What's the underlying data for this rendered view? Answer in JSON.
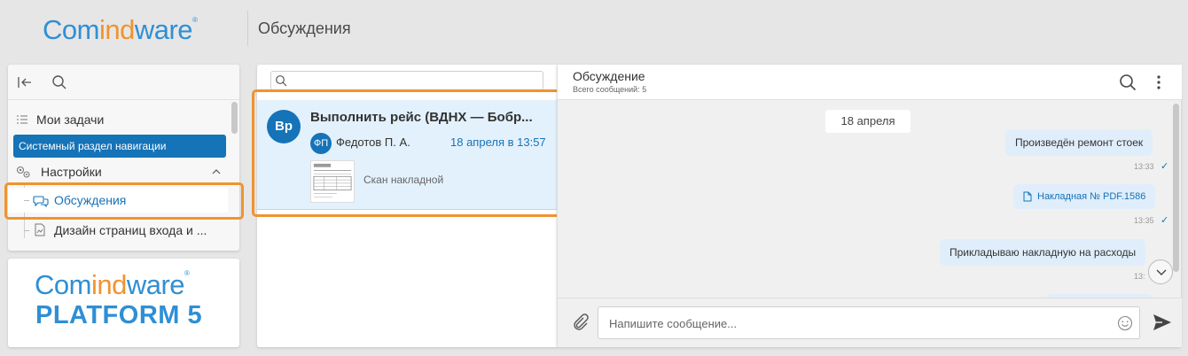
{
  "header": {
    "logo_part1": "Com",
    "logo_part2": "ind",
    "logo_part3": "ware",
    "logo_reg": "®",
    "page_title": "Обсуждения"
  },
  "nav": {
    "my_tasks": "Мои задачи",
    "system_section": "Системный раздел навигации",
    "settings": "Настройки",
    "discussions": "Обсуждения",
    "page_design": "Дизайн страниц входа и ..."
  },
  "logo_card": {
    "line1_part1": "Com",
    "line1_part2": "ind",
    "line1_part3": "ware",
    "reg": "®",
    "line2": "PLATFORM 5"
  },
  "discussion_list": {
    "search_placeholder": "",
    "items": [
      {
        "avatar": "Вр",
        "title": "Выполнить рейс (ВДНХ — Бобр...",
        "author_initials": "ФП",
        "author": "Федотов П. А.",
        "date": "18 апреля в 13:57",
        "attachment": "Скан накладной"
      }
    ]
  },
  "chat": {
    "title": "Обсуждение",
    "count": "Всего сообщений: 5",
    "date_divider": "18 апреля",
    "messages": [
      {
        "text": "Произведён ремонт стоек",
        "time": "13:33"
      },
      {
        "text": "Накладная № PDF.1586",
        "time": "13:35"
      },
      {
        "text": "Прикладываю накладную на расходы",
        "time": "13:"
      }
    ],
    "input_placeholder": "Напишите сообщение..."
  },
  "colors": {
    "brand_blue": "#1573b8",
    "logo_blue": "#2f8fd4",
    "highlight_orange": "#f0932f"
  }
}
